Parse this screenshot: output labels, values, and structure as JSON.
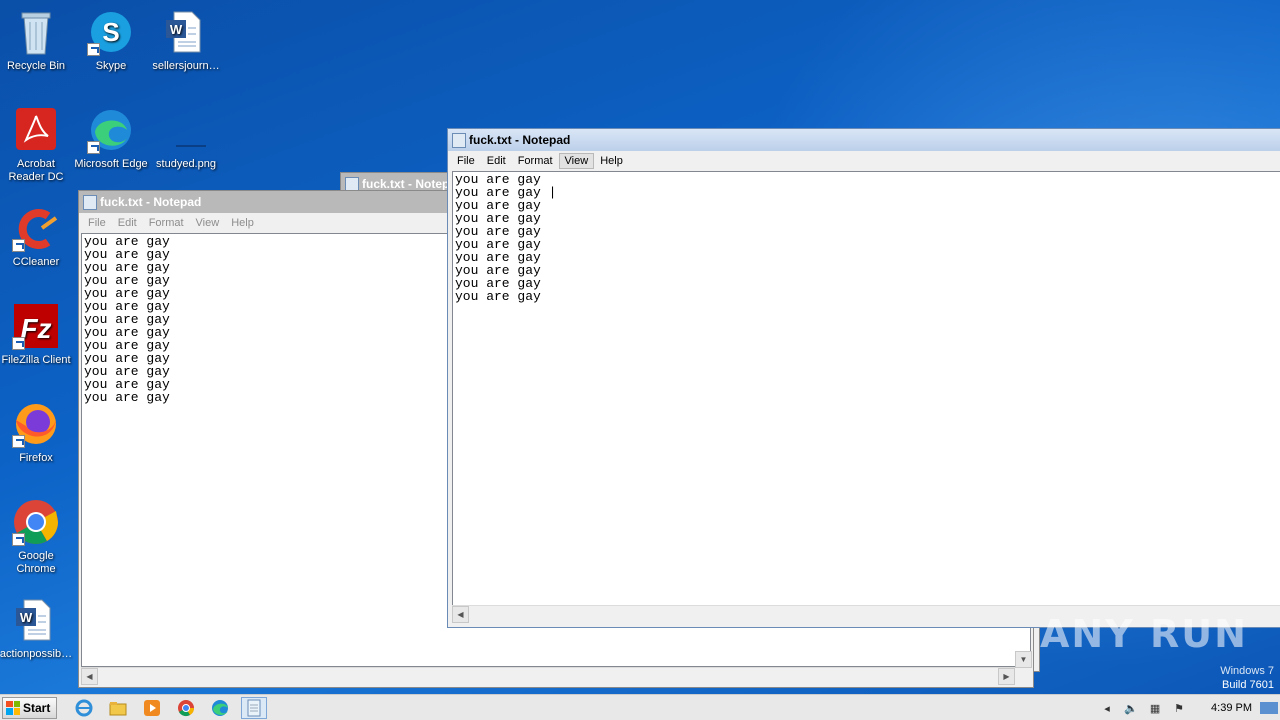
{
  "desktop": {
    "icons": [
      {
        "label": "Recycle Bin",
        "icon": "recycle-bin-icon"
      },
      {
        "label": "Skype",
        "icon": "skype-icon"
      },
      {
        "label": "sellersjourn…",
        "icon": "word-doc-icon"
      },
      {
        "label": "Acrobat Reader DC",
        "icon": "acrobat-icon"
      },
      {
        "label": "Microsoft Edge",
        "icon": "edge-icon"
      },
      {
        "label": "studyed.png",
        "icon": "png-file-icon"
      },
      {
        "label": "CCleaner",
        "icon": "ccleaner-icon"
      },
      {
        "label": "FileZilla Client",
        "icon": "filezilla-icon"
      },
      {
        "label": "Firefox",
        "icon": "firefox-icon"
      },
      {
        "label": "Google Chrome",
        "icon": "chrome-icon"
      },
      {
        "label": "actionpossib…",
        "icon": "word-doc-icon"
      }
    ],
    "build": "Build 7601",
    "build_partial": "Windows 7",
    "watermark": "ANY RUN"
  },
  "windows": {
    "back_title": "fuck.txt - Notepad",
    "left": {
      "title": "fuck.txt - Notepad",
      "menu": [
        "File",
        "Edit",
        "Format",
        "View",
        "Help"
      ],
      "text": "you are gay\nyou are gay\nyou are gay\nyou are gay\nyou are gay\nyou are gay\nyou are gay\nyou are gay\nyou are gay\nyou are gay\nyou are gay\nyou are gay\nyou are gay"
    },
    "right": {
      "title": "fuck.txt - Notepad",
      "menu": [
        "File",
        "Edit",
        "Format",
        "View",
        "Help"
      ],
      "text": "you are gay\nyou are gay |\nyou are gay\nyou are gay\nyou are gay\nyou are gay\nyou are gay\nyou are gay\nyou are gay\nyou are gay"
    }
  },
  "taskbar": {
    "start_label": "Start",
    "clock": "4:39 PM",
    "colors": {
      "accent": "#0d63c7"
    }
  }
}
